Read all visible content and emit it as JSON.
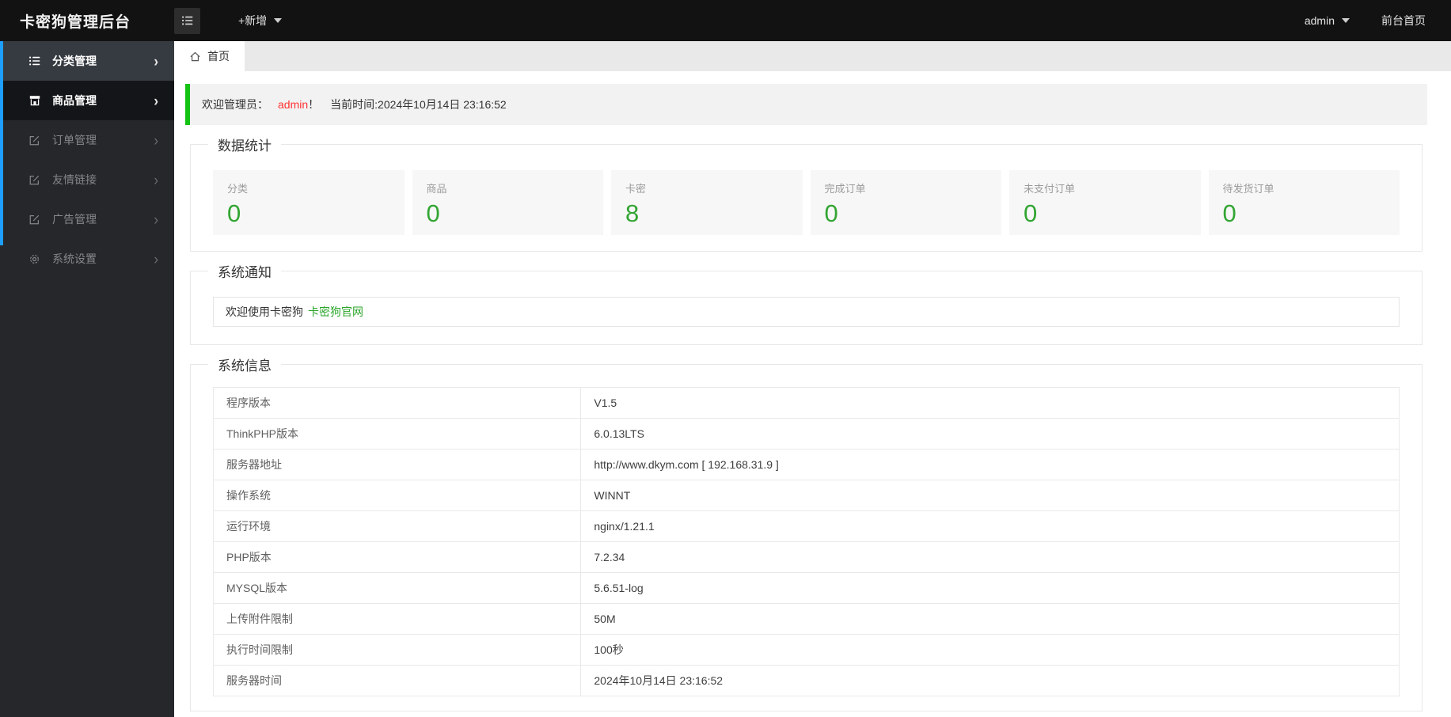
{
  "header": {
    "title": "卡密狗管理后台",
    "add_button": "+新增",
    "username": "admin",
    "frontend_link": "前台首页"
  },
  "sidebar": {
    "items": [
      {
        "label": "分类管理",
        "icon": "list-icon"
      },
      {
        "label": "商品管理",
        "icon": "shop-icon"
      },
      {
        "label": "订单管理",
        "icon": "edit-icon"
      },
      {
        "label": "友情链接",
        "icon": "edit-icon"
      },
      {
        "label": "广告管理",
        "icon": "edit-icon"
      },
      {
        "label": "系统设置",
        "icon": "gear-icon"
      }
    ],
    "chevron": "›"
  },
  "tabs": [
    {
      "label": "首页",
      "icon": "home-icon",
      "active": true
    }
  ],
  "welcome": {
    "prefix": "欢迎管理员：",
    "username": "admin",
    "suffix": "！",
    "time": "当前时间:2024年10月14日 23:16:52"
  },
  "stats": {
    "legend": "数据统计",
    "cards": [
      {
        "label": "分类",
        "value": "0"
      },
      {
        "label": "商品",
        "value": "0"
      },
      {
        "label": "卡密",
        "value": "8"
      },
      {
        "label": "完成订单",
        "value": "0"
      },
      {
        "label": "未支付订单",
        "value": "0"
      },
      {
        "label": "待发货订单",
        "value": "0"
      }
    ]
  },
  "notice": {
    "legend": "系统通知",
    "text": "欢迎使用卡密狗",
    "link": "卡密狗官网"
  },
  "sysinfo": {
    "legend": "系统信息",
    "rows": [
      {
        "label": "程序版本",
        "value": "V1.5"
      },
      {
        "label": "ThinkPHP版本",
        "value": "6.0.13LTS"
      },
      {
        "label": "服务器地址",
        "value": "http://www.dkym.com [ 192.168.31.9 ]"
      },
      {
        "label": "操作系统",
        "value": "WINNT"
      },
      {
        "label": "运行环境",
        "value": "nginx/1.21.1"
      },
      {
        "label": "PHP版本",
        "value": "7.2.34"
      },
      {
        "label": "MYSQL版本",
        "value": "5.6.51-log"
      },
      {
        "label": "上传附件限制",
        "value": "50M"
      },
      {
        "label": "执行时间限制",
        "value": "100秒"
      },
      {
        "label": "服务器时间",
        "value": "2024年10月14日 23:16:52"
      }
    ]
  },
  "colors": {
    "alert_border_green": "#14c314",
    "stat_number_green": "#32a532",
    "link_green": "#2aa52a",
    "admin_red": "#ff3434",
    "scrollbar_blue": "#1e9fff",
    "header_bg": "#121212",
    "sidebar_bg": "#25272b"
  }
}
